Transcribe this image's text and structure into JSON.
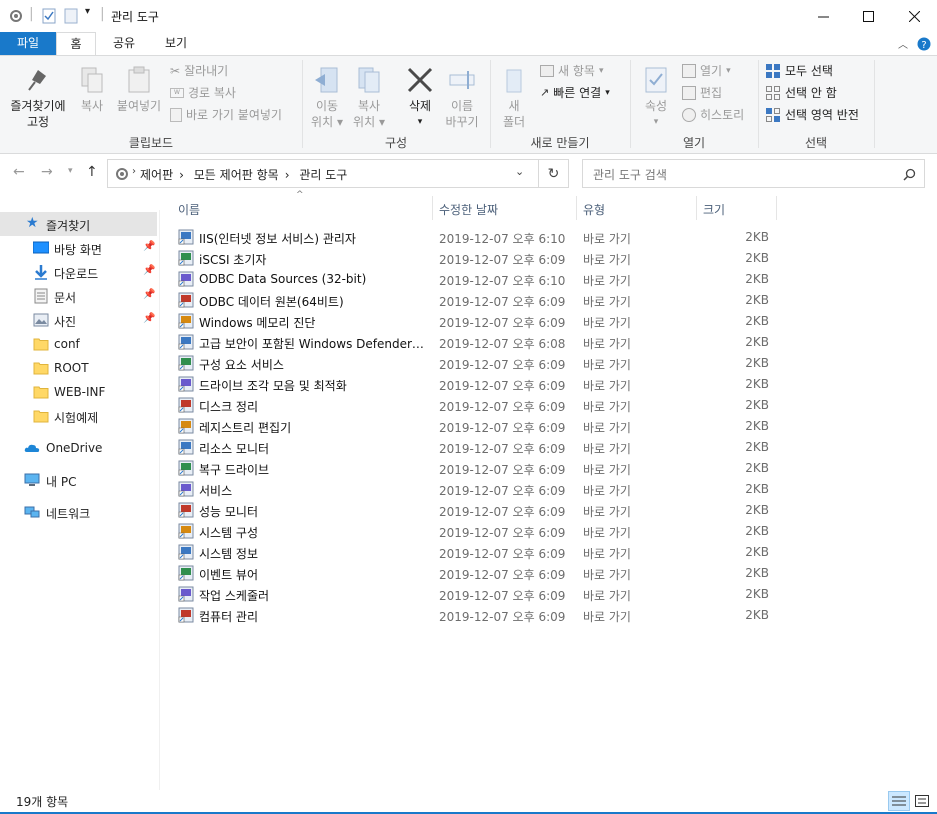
{
  "window": {
    "title": "관리 도구",
    "minimize_icon": "minimize-icon",
    "maximize_icon": "maximize-icon",
    "close_icon": "close-icon"
  },
  "ribbon_tabs": [
    {
      "label": "파일"
    },
    {
      "label": "홈"
    },
    {
      "label": "공유"
    },
    {
      "label": "보기"
    }
  ],
  "ribbon": {
    "clipboard": {
      "pin_label_line1": "즐겨찾기에",
      "pin_label_line2": "고정",
      "copy_label": "복사",
      "paste_label": "붙여넣기",
      "cut_label": "잘라내기",
      "copy_path_label": "경로 복사",
      "paste_shortcut_label": "바로 가기 붙여넣기",
      "group_label": "클립보드"
    },
    "organize": {
      "move_line1": "이동",
      "move_line2": "위치",
      "copy_line1": "복사",
      "copy_line2": "위치",
      "delete_label": "삭제",
      "rename_line1": "이름",
      "rename_line2": "바꾸기",
      "group_label": "구성"
    },
    "new": {
      "new_folder_line1": "새",
      "new_folder_line2": "폴더",
      "new_item_label": "새 항목",
      "easy_access_label": "빠른 연결",
      "group_label": "새로 만들기"
    },
    "open": {
      "properties_label": "속성",
      "open_label": "열기",
      "edit_label": "편집",
      "history_label": "히스토리",
      "group_label": "열기"
    },
    "select": {
      "select_all_label": "모두 선택",
      "select_none_label": "선택 안 함",
      "invert_label": "선택 영역 반전",
      "group_label": "선택"
    }
  },
  "address": {
    "crumbs": [
      "제어판",
      "모든 제어판 항목",
      "관리 도구"
    ],
    "search_placeholder": "관리 도구 검색"
  },
  "nav": {
    "quick_access": "즐겨찾기",
    "items": [
      {
        "label": "바탕 화면",
        "pinned": true
      },
      {
        "label": "다운로드",
        "pinned": true
      },
      {
        "label": "문서",
        "pinned": true
      },
      {
        "label": "사진",
        "pinned": true
      },
      {
        "label": "conf",
        "pinned": false
      },
      {
        "label": "ROOT",
        "pinned": false
      },
      {
        "label": "WEB-INF",
        "pinned": false
      },
      {
        "label": "시험예제",
        "pinned": false
      }
    ],
    "onedrive": "OneDrive",
    "this_pc": "내 PC",
    "network": "네트워크"
  },
  "columns": {
    "name": "이름",
    "modified": "수정한 날짜",
    "type": "유형",
    "size": "크기"
  },
  "files": [
    {
      "name": "IIS(인터넷 정보 서비스) 관리자",
      "date": "2019-12-07 오후 6:10",
      "type": "바로 가기",
      "size": "2KB",
      "icon": "iis-manager-icon"
    },
    {
      "name": "iSCSI 초기자",
      "date": "2019-12-07 오후 6:09",
      "type": "바로 가기",
      "size": "2KB",
      "icon": "iscsi-icon"
    },
    {
      "name": "ODBC Data Sources (32-bit)",
      "date": "2019-12-07 오후 6:10",
      "type": "바로 가기",
      "size": "2KB",
      "icon": "odbc-icon"
    },
    {
      "name": "ODBC 데이터 원본(64비트)",
      "date": "2019-12-07 오후 6:09",
      "type": "바로 가기",
      "size": "2KB",
      "icon": "odbc-icon"
    },
    {
      "name": "Windows 메모리 진단",
      "date": "2019-12-07 오후 6:09",
      "type": "바로 가기",
      "size": "2KB",
      "icon": "memory-diagnostic-icon"
    },
    {
      "name": "고급 보안이 포함된 Windows Defender 방화벽",
      "date": "2019-12-07 오후 6:08",
      "type": "바로 가기",
      "size": "2KB",
      "icon": "firewall-icon"
    },
    {
      "name": "구성 요소 서비스",
      "date": "2019-12-07 오후 6:09",
      "type": "바로 가기",
      "size": "2KB",
      "icon": "component-services-icon"
    },
    {
      "name": "드라이브 조각 모음 및 최적화",
      "date": "2019-12-07 오후 6:09",
      "type": "바로 가기",
      "size": "2KB",
      "icon": "defrag-icon"
    },
    {
      "name": "디스크 정리",
      "date": "2019-12-07 오후 6:09",
      "type": "바로 가기",
      "size": "2KB",
      "icon": "disk-cleanup-icon"
    },
    {
      "name": "레지스트리 편집기",
      "date": "2019-12-07 오후 6:09",
      "type": "바로 가기",
      "size": "2KB",
      "icon": "registry-editor-icon"
    },
    {
      "name": "리소스 모니터",
      "date": "2019-12-07 오후 6:09",
      "type": "바로 가기",
      "size": "2KB",
      "icon": "resource-monitor-icon"
    },
    {
      "name": "복구 드라이브",
      "date": "2019-12-07 오후 6:09",
      "type": "바로 가기",
      "size": "2KB",
      "icon": "recovery-drive-icon"
    },
    {
      "name": "서비스",
      "date": "2019-12-07 오후 6:09",
      "type": "바로 가기",
      "size": "2KB",
      "icon": "services-icon"
    },
    {
      "name": "성능 모니터",
      "date": "2019-12-07 오후 6:09",
      "type": "바로 가기",
      "size": "2KB",
      "icon": "performance-monitor-icon"
    },
    {
      "name": "시스템 구성",
      "date": "2019-12-07 오후 6:09",
      "type": "바로 가기",
      "size": "2KB",
      "icon": "system-config-icon"
    },
    {
      "name": "시스템 정보",
      "date": "2019-12-07 오후 6:09",
      "type": "바로 가기",
      "size": "2KB",
      "icon": "system-info-icon"
    },
    {
      "name": "이벤트 뷰어",
      "date": "2019-12-07 오후 6:09",
      "type": "바로 가기",
      "size": "2KB",
      "icon": "event-viewer-icon"
    },
    {
      "name": "작업 스케줄러",
      "date": "2019-12-07 오후 6:09",
      "type": "바로 가기",
      "size": "2KB",
      "icon": "task-scheduler-icon"
    },
    {
      "name": "컴퓨터 관리",
      "date": "2019-12-07 오후 6:09",
      "type": "바로 가기",
      "size": "2KB",
      "icon": "computer-management-icon"
    }
  ],
  "status": {
    "item_count": "19개 항목"
  },
  "colors": {
    "accent": "#1979ca",
    "ribbon_bg": "#f5f6f7",
    "selected_nav": "#e5e5e5"
  }
}
